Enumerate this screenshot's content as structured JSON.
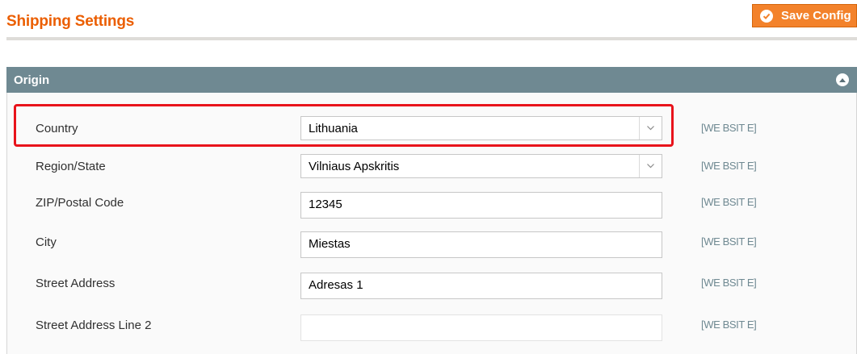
{
  "header": {
    "title": "Shipping Settings",
    "save_label": "Save Config",
    "accent": "#eb5e00"
  },
  "section": {
    "title": "Origin",
    "collapse_icon": "chevron-up-icon"
  },
  "fields": {
    "country": {
      "label": "Country",
      "value": "Lithuania",
      "scope": "[WE BSIT E]",
      "type": "select"
    },
    "region": {
      "label": "Region/State",
      "value": "Vilniaus Apskritis",
      "scope": "[WE BSIT E]",
      "type": "select"
    },
    "zip": {
      "label": "ZIP/Postal Code",
      "value": "12345",
      "scope": "[WE BSIT E]",
      "type": "text"
    },
    "city": {
      "label": "City",
      "value": "Miestas",
      "scope": "[WE BSIT E]",
      "type": "text"
    },
    "street1": {
      "label": "Street Address",
      "value": "Adresas 1",
      "scope": "[WE BSIT E]",
      "type": "text"
    },
    "street2": {
      "label": "Street Address Line 2",
      "value": "",
      "scope": "[WE BSIT E]",
      "type": "text"
    }
  },
  "highlight_color": "#e8131b"
}
